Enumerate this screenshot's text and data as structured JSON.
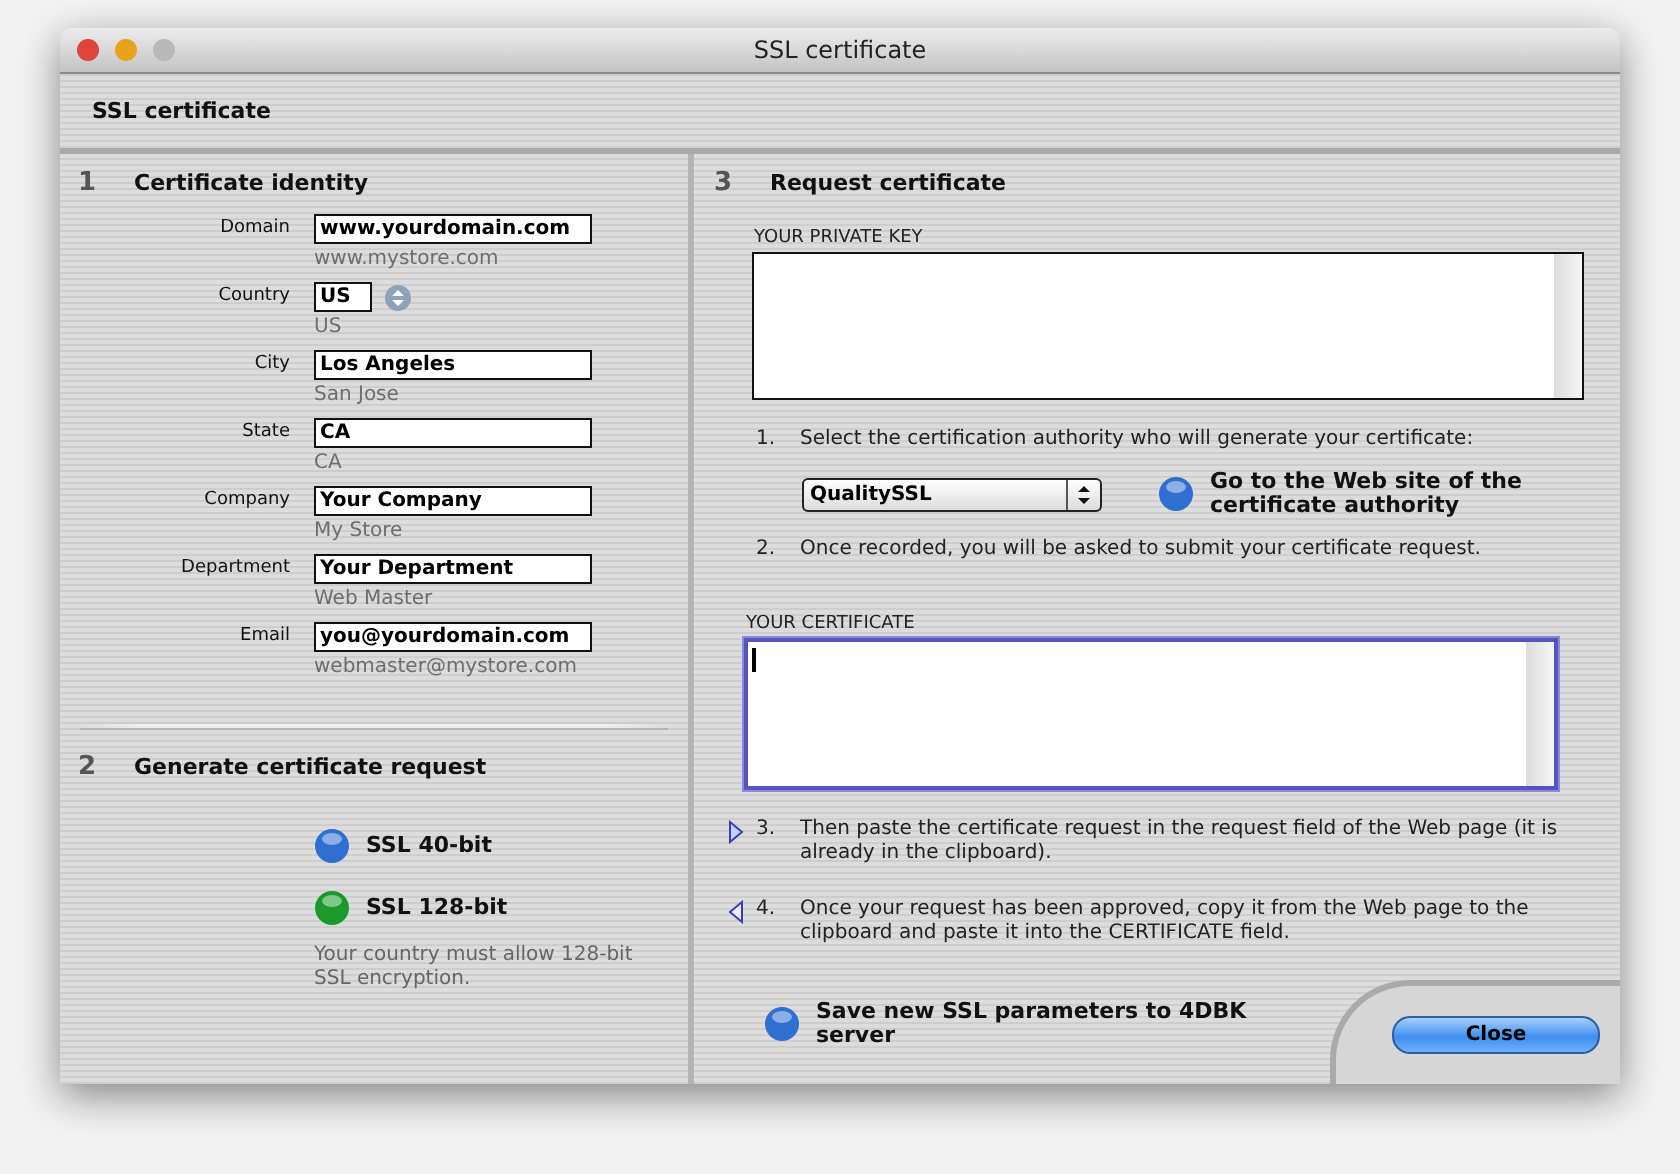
{
  "window": {
    "title": "SSL certificate"
  },
  "header": {
    "title": "SSL certificate"
  },
  "identity": {
    "number": "1",
    "title": "Certificate identity",
    "fields": [
      {
        "label": "Domain",
        "value": "www.yourdomain.com",
        "note": "www.mystore.com",
        "kind": "text"
      },
      {
        "label": "Country",
        "value": "US",
        "note": "US",
        "kind": "stepper"
      },
      {
        "label": "City",
        "value": "Los Angeles",
        "note": "San Jose",
        "kind": "text"
      },
      {
        "label": "State",
        "value": "CA",
        "note": "CA",
        "kind": "text"
      },
      {
        "label": "Company",
        "value": "Your Company",
        "note": "My Store",
        "kind": "text"
      },
      {
        "label": "Department",
        "value": "Your Department",
        "note": "Web Master",
        "kind": "text"
      },
      {
        "label": "Email",
        "value": "you@yourdomain.com",
        "note": "webmaster@mystore.com",
        "kind": "text"
      }
    ]
  },
  "generate": {
    "number": "2",
    "title": "Generate certificate request",
    "buttons": [
      {
        "label": "SSL 40-bit",
        "color": "#2f6fd0"
      },
      {
        "label": "SSL 128-bit",
        "color": "#1a9a2a"
      }
    ],
    "note": "Your country must allow 128-bit SSL encryption."
  },
  "request": {
    "number": "3",
    "title": "Request certificate",
    "private_key": {
      "label": "YOUR PRIVATE KEY",
      "focused": false
    },
    "steps_before": [
      {
        "number": "1.",
        "text": "Select the certification authority who will generate your certificate:"
      }
    ],
    "authority": {
      "value": "QualitySSL"
    },
    "authority_button": {
      "label": "Go to the Web site of the certificate authority",
      "color": "#2f6fd0"
    },
    "steps_middle": [
      {
        "number": "2.",
        "text": "Once recorded, you will be asked to submit your certificate request."
      }
    ],
    "certificate": {
      "label": "YOUR CERTIFICATE",
      "focused": true
    },
    "steps_after": [
      {
        "number": "3.",
        "text": "Then paste the certificate request in the request field of the Web page (it is already in the clipboard).",
        "kind": "forward"
      },
      {
        "number": "4.",
        "text": "Once your request has been approved, copy it from the Web page to the clipboard and paste it into the CERTIFICATE field.",
        "kind": "back"
      }
    ],
    "save_button": {
      "label": "Save new SSL parameters to 4DBK server",
      "color": "#2f6fd0"
    }
  },
  "close_button": {
    "label": "Close"
  }
}
